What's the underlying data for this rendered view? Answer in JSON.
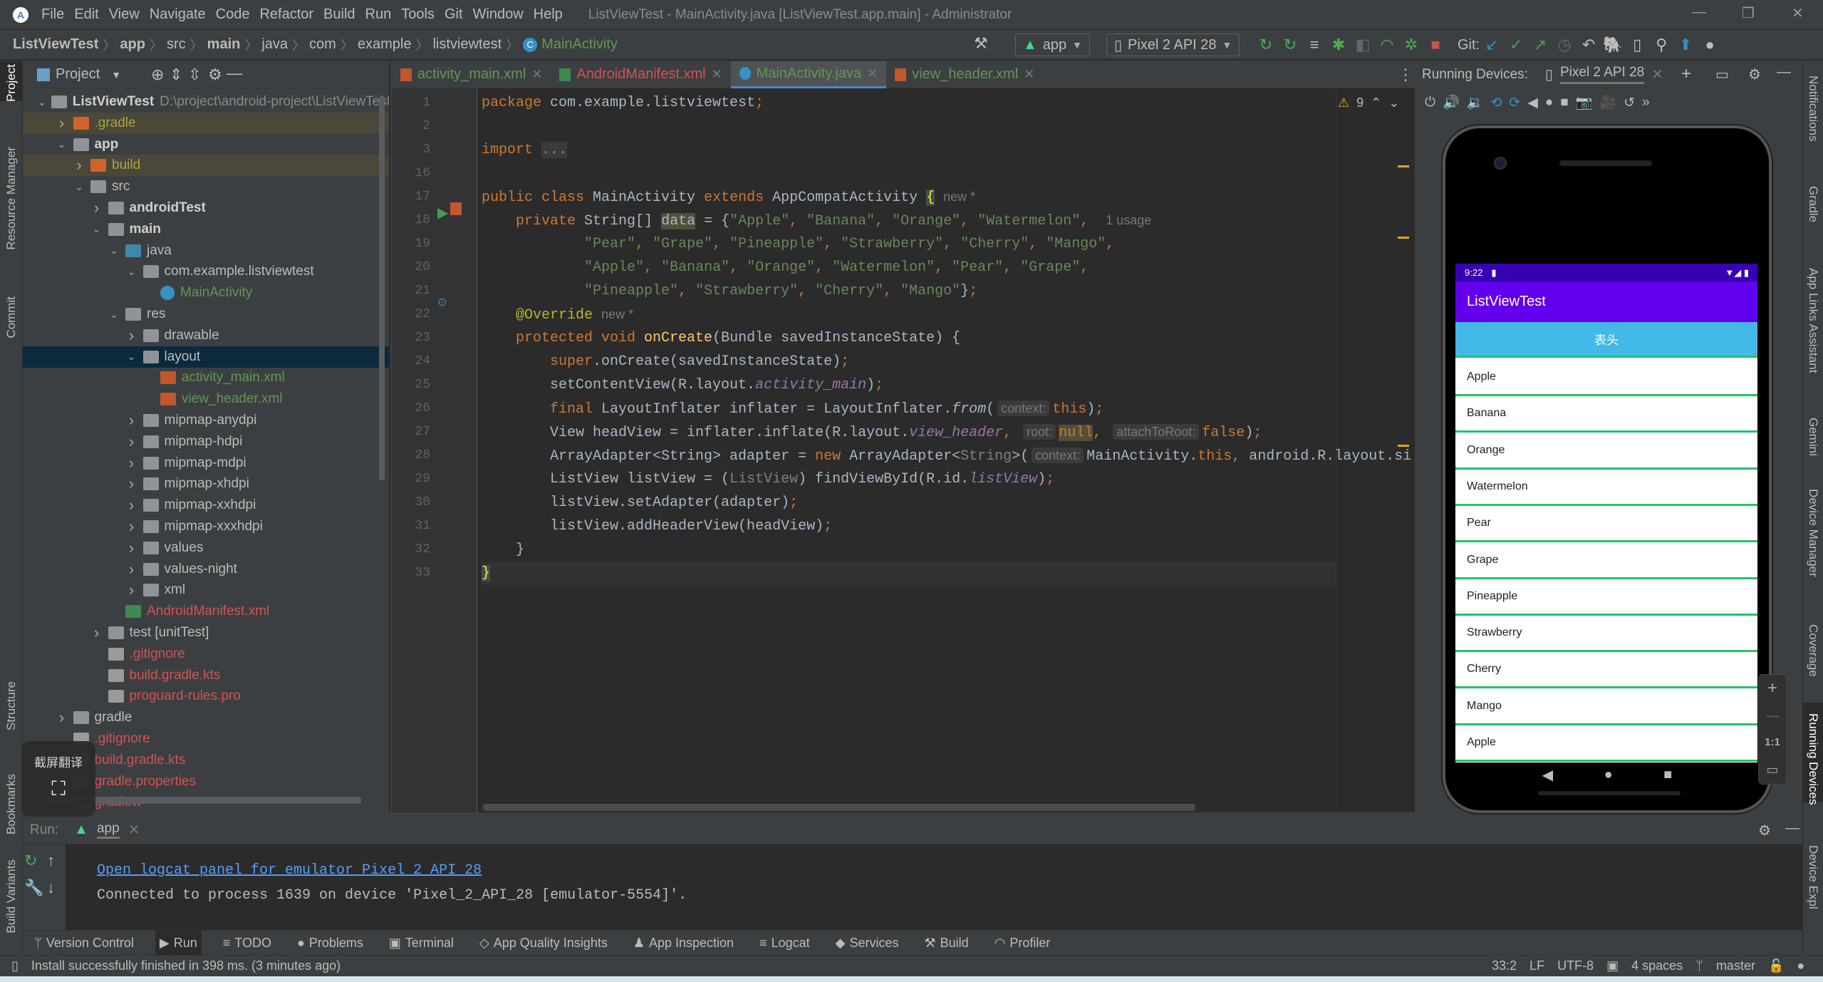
{
  "menubar": {
    "items": [
      "File",
      "Edit",
      "View",
      "Navigate",
      "Code",
      "Refactor",
      "Build",
      "Run",
      "Tools",
      "Git",
      "Window",
      "Help"
    ],
    "title": "ListViewTest - MainActivity.java [ListViewTest.app.main] - Administrator"
  },
  "breadcrumb": [
    "ListViewTest",
    "app",
    "src",
    "main",
    "java",
    "com",
    "example",
    "listviewtest",
    "MainActivity"
  ],
  "toolbar": {
    "run_config": "app",
    "device": "Pixel 2 API 28",
    "git_label": "Git:"
  },
  "project_panel": {
    "title": "Project",
    "tree": [
      {
        "d": 0,
        "a": "open",
        "i": "module",
        "label": "ListViewTest",
        "extra": "D:\\project\\android-project\\ListViewTest",
        "c": "bold"
      },
      {
        "d": 1,
        "a": "closed",
        "i": "folder-orange",
        "label": ".gradle",
        "c": "excluded",
        "bg": "excluded"
      },
      {
        "d": 1,
        "a": "open",
        "i": "module",
        "label": "app",
        "c": "bold"
      },
      {
        "d": 2,
        "a": "closed",
        "i": "folder-orange",
        "label": "build",
        "c": "excluded",
        "bg": "excluded"
      },
      {
        "d": 2,
        "a": "open",
        "i": "folder",
        "label": "src",
        "c": "normal"
      },
      {
        "d": 3,
        "a": "closed",
        "i": "module",
        "label": "androidTest",
        "c": "bold"
      },
      {
        "d": 3,
        "a": "open",
        "i": "module",
        "label": "main",
        "c": "bold"
      },
      {
        "d": 4,
        "a": "open",
        "i": "folder-blue",
        "label": "java",
        "c": "normal"
      },
      {
        "d": 5,
        "a": "open",
        "i": "package",
        "label": "com.example.listviewtest",
        "c": "normal"
      },
      {
        "d": 6,
        "a": "none",
        "i": "class",
        "label": "MainActivity",
        "c": "green"
      },
      {
        "d": 4,
        "a": "open",
        "i": "folder-res",
        "label": "res",
        "c": "normal"
      },
      {
        "d": 5,
        "a": "closed",
        "i": "folder",
        "label": "drawable",
        "c": "normal"
      },
      {
        "d": 5,
        "a": "open",
        "i": "folder",
        "label": "layout",
        "c": "normal",
        "bg": "selected"
      },
      {
        "d": 6,
        "a": "none",
        "i": "xml",
        "label": "activity_main.xml",
        "c": "green"
      },
      {
        "d": 6,
        "a": "none",
        "i": "xml",
        "label": "view_header.xml",
        "c": "green"
      },
      {
        "d": 5,
        "a": "closed",
        "i": "folder",
        "label": "mipmap-anydpi",
        "c": "normal"
      },
      {
        "d": 5,
        "a": "closed",
        "i": "folder",
        "label": "mipmap-hdpi",
        "c": "normal"
      },
      {
        "d": 5,
        "a": "closed",
        "i": "folder",
        "label": "mipmap-mdpi",
        "c": "normal"
      },
      {
        "d": 5,
        "a": "closed",
        "i": "folder",
        "label": "mipmap-xhdpi",
        "c": "normal"
      },
      {
        "d": 5,
        "a": "closed",
        "i": "folder",
        "label": "mipmap-xxhdpi",
        "c": "normal"
      },
      {
        "d": 5,
        "a": "closed",
        "i": "folder",
        "label": "mipmap-xxxhdpi",
        "c": "normal"
      },
      {
        "d": 5,
        "a": "closed",
        "i": "folder",
        "label": "values",
        "c": "normal"
      },
      {
        "d": 5,
        "a": "closed",
        "i": "folder",
        "label": "values-night",
        "c": "normal"
      },
      {
        "d": 5,
        "a": "closed",
        "i": "folder",
        "label": "xml",
        "c": "normal"
      },
      {
        "d": 4,
        "a": "none",
        "i": "manifest",
        "label": "AndroidManifest.xml",
        "c": "red"
      },
      {
        "d": 3,
        "a": "closed",
        "i": "module-test",
        "label": "test [unitTest]",
        "c": "normal"
      },
      {
        "d": 3,
        "a": "none",
        "i": "file",
        "label": ".gitignore",
        "c": "red"
      },
      {
        "d": 3,
        "a": "none",
        "i": "gradle",
        "label": "build.gradle.kts",
        "c": "red"
      },
      {
        "d": 3,
        "a": "none",
        "i": "file",
        "label": "proguard-rules.pro",
        "c": "red"
      },
      {
        "d": 1,
        "a": "closed",
        "i": "folder",
        "label": "gradle",
        "c": "normal"
      },
      {
        "d": 1,
        "a": "none",
        "i": "file",
        "label": ".gitignore",
        "c": "red"
      },
      {
        "d": 1,
        "a": "none",
        "i": "gradle",
        "label": "build.gradle.kts",
        "c": "red"
      },
      {
        "d": 1,
        "a": "none",
        "i": "file",
        "label": "gradle.properties",
        "c": "red"
      },
      {
        "d": 1,
        "a": "none",
        "i": "file",
        "label": "gradlew",
        "c": "red"
      }
    ]
  },
  "editor_tabs": [
    {
      "label": "activity_main.xml",
      "icon": "xml",
      "color": "#629755",
      "active": false
    },
    {
      "label": "AndroidManifest.xml",
      "icon": "manifest",
      "color": "#d25252",
      "active": false
    },
    {
      "label": "MainActivity.java",
      "icon": "class",
      "color": "#629755",
      "active": true
    },
    {
      "label": "view_header.xml",
      "icon": "xml",
      "color": "#629755",
      "active": false
    }
  ],
  "editor": {
    "warnings": "9",
    "lines": [
      {
        "n": "1",
        "tokens": [
          [
            "kw",
            "package"
          ],
          [
            "pl",
            " com.example.listviewtest"
          ],
          [
            "kw",
            ";"
          ]
        ]
      },
      {
        "n": "2",
        "tokens": []
      },
      {
        "n": "3",
        "tokens": [
          [
            "kw",
            "import"
          ],
          [
            "pl",
            " "
          ],
          [
            "fold",
            "..."
          ]
        ]
      },
      {
        "n": "16",
        "tokens": []
      },
      {
        "n": "17",
        "tokens": [
          [
            "kw",
            "public class "
          ],
          [
            "pl",
            "MainActivity "
          ],
          [
            "kw",
            "extends "
          ],
          [
            "pl",
            "AppCompatActivity "
          ],
          [
            "brace",
            "{"
          ],
          [
            "nhint",
            "new *"
          ]
        ]
      },
      {
        "n": "18",
        "tokens": [
          [
            "pl",
            "    "
          ],
          [
            "kw",
            "private "
          ],
          [
            "pl",
            "String[] "
          ],
          [
            "hl",
            "data"
          ],
          [
            "pl",
            " = {"
          ],
          [
            "str",
            "\"Apple\""
          ],
          [
            "kw",
            ", "
          ],
          [
            "str",
            "\"Banana\""
          ],
          [
            "kw",
            ", "
          ],
          [
            "str",
            "\"Orange\""
          ],
          [
            "kw",
            ", "
          ],
          [
            "str",
            "\"Watermelon\""
          ],
          [
            "kw",
            ", "
          ],
          [
            "nhint",
            "1 usage"
          ]
        ]
      },
      {
        "n": "19",
        "tokens": [
          [
            "pl",
            "            "
          ],
          [
            "str",
            "\"Pear\""
          ],
          [
            "kw",
            ", "
          ],
          [
            "str",
            "\"Grape\""
          ],
          [
            "kw",
            ", "
          ],
          [
            "str",
            "\"Pineapple\""
          ],
          [
            "kw",
            ", "
          ],
          [
            "str",
            "\"Strawberry\""
          ],
          [
            "kw",
            ", "
          ],
          [
            "str",
            "\"Cherry\""
          ],
          [
            "kw",
            ", "
          ],
          [
            "str",
            "\"Mango\""
          ],
          [
            "kw",
            ","
          ]
        ]
      },
      {
        "n": "20",
        "tokens": [
          [
            "pl",
            "            "
          ],
          [
            "str",
            "\"Apple\""
          ],
          [
            "kw",
            ", "
          ],
          [
            "str",
            "\"Banana\""
          ],
          [
            "kw",
            ", "
          ],
          [
            "str",
            "\"Orange\""
          ],
          [
            "kw",
            ", "
          ],
          [
            "str",
            "\"Watermelon\""
          ],
          [
            "kw",
            ", "
          ],
          [
            "str",
            "\"Pear\""
          ],
          [
            "kw",
            ", "
          ],
          [
            "str",
            "\"Grape\""
          ],
          [
            "kw",
            ","
          ]
        ]
      },
      {
        "n": "21",
        "tokens": [
          [
            "pl",
            "            "
          ],
          [
            "str",
            "\"Pineapple\""
          ],
          [
            "kw",
            ", "
          ],
          [
            "str",
            "\"Strawberry\""
          ],
          [
            "kw",
            ", "
          ],
          [
            "str",
            "\"Cherry\""
          ],
          [
            "kw",
            ", "
          ],
          [
            "str",
            "\"Mango\""
          ],
          [
            "pl",
            "}"
          ],
          [
            "kw",
            ";"
          ]
        ]
      },
      {
        "n": "22",
        "tokens": [
          [
            "pl",
            "    "
          ],
          [
            "ann",
            "@Override"
          ],
          [
            "nhint",
            "new *"
          ]
        ]
      },
      {
        "n": "23",
        "tokens": [
          [
            "pl",
            "    "
          ],
          [
            "kw",
            "protected void "
          ],
          [
            "fn",
            "onCreate"
          ],
          [
            "pl",
            "(Bundle savedInstanceState) {"
          ]
        ]
      },
      {
        "n": "24",
        "tokens": [
          [
            "pl",
            "        "
          ],
          [
            "kw",
            "super"
          ],
          [
            "pl",
            ".onCreate(savedInstanceState)"
          ],
          [
            "kw",
            ";"
          ]
        ]
      },
      {
        "n": "25",
        "tokens": [
          [
            "pl",
            "        setContentView(R.layout."
          ],
          [
            "fld",
            "activity_main"
          ],
          [
            "pl",
            ")"
          ],
          [
            "kw",
            ";"
          ]
        ]
      },
      {
        "n": "26",
        "tokens": [
          [
            "pl",
            "        "
          ],
          [
            "kw",
            "final "
          ],
          [
            "pl",
            "LayoutInflater inflater = LayoutInflater."
          ],
          [
            "fnit",
            "from"
          ],
          [
            "pl",
            "("
          ],
          [
            "hint",
            "context:"
          ],
          [
            "kw",
            "this"
          ],
          [
            "pl",
            ")"
          ],
          [
            "kw",
            ";"
          ]
        ]
      },
      {
        "n": "27",
        "tokens": [
          [
            "pl",
            "        View headView = inflater.inflate(R.layout."
          ],
          [
            "fld",
            "view_header"
          ],
          [
            "kw",
            ", "
          ],
          [
            "hint",
            "root:"
          ],
          [
            "kwhl",
            "null"
          ],
          [
            "kw",
            ", "
          ],
          [
            "hint",
            "attachToRoot:"
          ],
          [
            "kw",
            "false"
          ],
          [
            "pl",
            ")"
          ],
          [
            "kw",
            ";"
          ]
        ]
      },
      {
        "n": "28",
        "tokens": [
          [
            "pl",
            "        ArrayAdapter<String> adapter = "
          ],
          [
            "kw",
            "new "
          ],
          [
            "pl",
            "ArrayAdapter<"
          ],
          [
            "gray",
            "String"
          ],
          [
            "pl",
            ">("
          ],
          [
            "hint",
            "context:"
          ],
          [
            "pl",
            "MainActivity."
          ],
          [
            "kw",
            "this"
          ],
          [
            "kw",
            ", "
          ],
          [
            "pl",
            "android.R.layout.si"
          ]
        ]
      },
      {
        "n": "29",
        "tokens": [
          [
            "pl",
            "        ListView listView = ("
          ],
          [
            "gray",
            "ListView"
          ],
          [
            "pl",
            ") findViewById(R.id."
          ],
          [
            "fld",
            "listView"
          ],
          [
            "pl",
            ")"
          ],
          [
            "kw",
            ";"
          ]
        ]
      },
      {
        "n": "30",
        "tokens": [
          [
            "pl",
            "        listView.setAdapter(adapter)"
          ],
          [
            "kw",
            ";"
          ]
        ]
      },
      {
        "n": "31",
        "tokens": [
          [
            "pl",
            "        listView.addHeaderView(headView)"
          ],
          [
            "kw",
            ";"
          ]
        ]
      },
      {
        "n": "32",
        "tokens": [
          [
            "pl",
            "    }"
          ]
        ]
      },
      {
        "n": "33",
        "tokens": [
          [
            "brace",
            "}"
          ]
        ]
      }
    ]
  },
  "running_devices": {
    "label": "Running Devices:",
    "tab": "Pixel 2 API 28",
    "zoom_controls": {
      "one_to_one": "1:1"
    },
    "phone": {
      "time": "9:22",
      "app_title": "ListViewTest",
      "header": "表头",
      "items": [
        "Apple",
        "Banana",
        "Orange",
        "Watermelon",
        "Pear",
        "Grape",
        "Pineapple",
        "Strawberry",
        "Cherry",
        "Mango",
        "Apple"
      ],
      "colors": {
        "status_bar": "#3700b3",
        "action_bar": "#6200ee",
        "header": "#43b9e8",
        "divider": "#20c36a"
      }
    }
  },
  "left_stripe": [
    "Project",
    "Resource Manager",
    "Commit",
    "Structure",
    "Bookmarks",
    "Build Variants"
  ],
  "right_stripe": [
    "Notifications",
    "Gradle",
    "App Links Assistant",
    "Gemini",
    "Device Manager",
    "Coverage",
    "Running Devices",
    "Device Expl"
  ],
  "run_panel": {
    "label": "Run:",
    "tab": "app",
    "link": "Open logcat panel for emulator Pixel 2 API 28",
    "message": "Connected to process 1639 on device 'Pixel_2_API_28 [emulator-5554]'."
  },
  "bottom_tools": [
    "Version Control",
    "Run",
    "TODO",
    "Problems",
    "Terminal",
    "App Quality Insights",
    "App Inspection",
    "Logcat",
    "Services",
    "Build",
    "Profiler"
  ],
  "status_bar": {
    "message": "Install successfully finished in 398 ms. (3 minutes ago)",
    "position": "33:2",
    "line_sep": "LF",
    "encoding": "UTF-8",
    "indent": "4 spaces",
    "branch": "master"
  },
  "overlay": {
    "label": "截屏翻译"
  }
}
